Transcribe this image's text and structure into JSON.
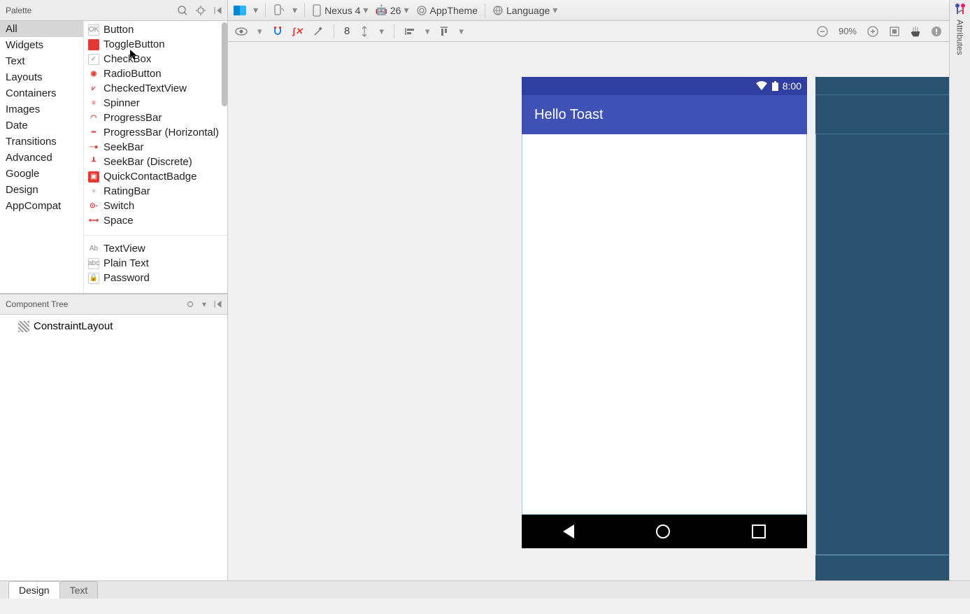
{
  "palette": {
    "title": "Palette",
    "categories": [
      "All",
      "Widgets",
      "Text",
      "Layouts",
      "Containers",
      "Images",
      "Date",
      "Transitions",
      "Advanced",
      "Google",
      "Design",
      "AppCompat"
    ],
    "selected_category": 0,
    "components_a": [
      {
        "icon": "ok",
        "label": "Button"
      },
      {
        "icon": "fill",
        "label": "ToggleButton"
      },
      {
        "icon": "check",
        "label": "CheckBox"
      },
      {
        "icon": "radio",
        "label": "RadioButton"
      },
      {
        "icon": "ctv",
        "label": "CheckedTextView"
      },
      {
        "icon": "spinner",
        "label": "Spinner"
      },
      {
        "icon": "arc",
        "label": "ProgressBar"
      },
      {
        "icon": "hbar",
        "label": "ProgressBar (Horizontal)"
      },
      {
        "icon": "seek",
        "label": "SeekBar"
      },
      {
        "icon": "seekd",
        "label": "SeekBar (Discrete)"
      },
      {
        "icon": "badge",
        "label": "QuickContactBadge"
      },
      {
        "icon": "star",
        "label": "RatingBar"
      },
      {
        "icon": "switch",
        "label": "Switch"
      },
      {
        "icon": "space",
        "label": "Space"
      }
    ],
    "components_b": [
      {
        "icon": "ab",
        "label": "TextView"
      },
      {
        "icon": "abc",
        "label": "Plain Text"
      },
      {
        "icon": "lock",
        "label": "Password"
      }
    ]
  },
  "component_tree": {
    "title": "Component Tree",
    "root": "ConstraintLayout"
  },
  "top_toolbar": {
    "device": "Nexus 4",
    "api": "26",
    "theme": "AppTheme",
    "language": "Language"
  },
  "sub_toolbar": {
    "margin": "8",
    "zoom": "90%"
  },
  "preview": {
    "time": "8:00",
    "app_title": "Hello Toast"
  },
  "right_panel": {
    "label": "Attributes"
  },
  "bottom_tabs": {
    "design": "Design",
    "text": "Text"
  },
  "icons": {
    "search": "search-icon",
    "gear": "gear-icon",
    "collapse": "collapse-icon",
    "eye": "eye-icon",
    "magnet": "magnet-icon",
    "fx": "fx-icon",
    "wand": "wand-icon",
    "vspace": "vspace-icon",
    "halign": "halign-icon",
    "valign": "valign-icon",
    "zoomout": "zoom-out-icon",
    "zoomin": "zoom-in-icon",
    "fit": "fit-icon",
    "pan": "pan-icon",
    "warn": "warning-icon"
  }
}
